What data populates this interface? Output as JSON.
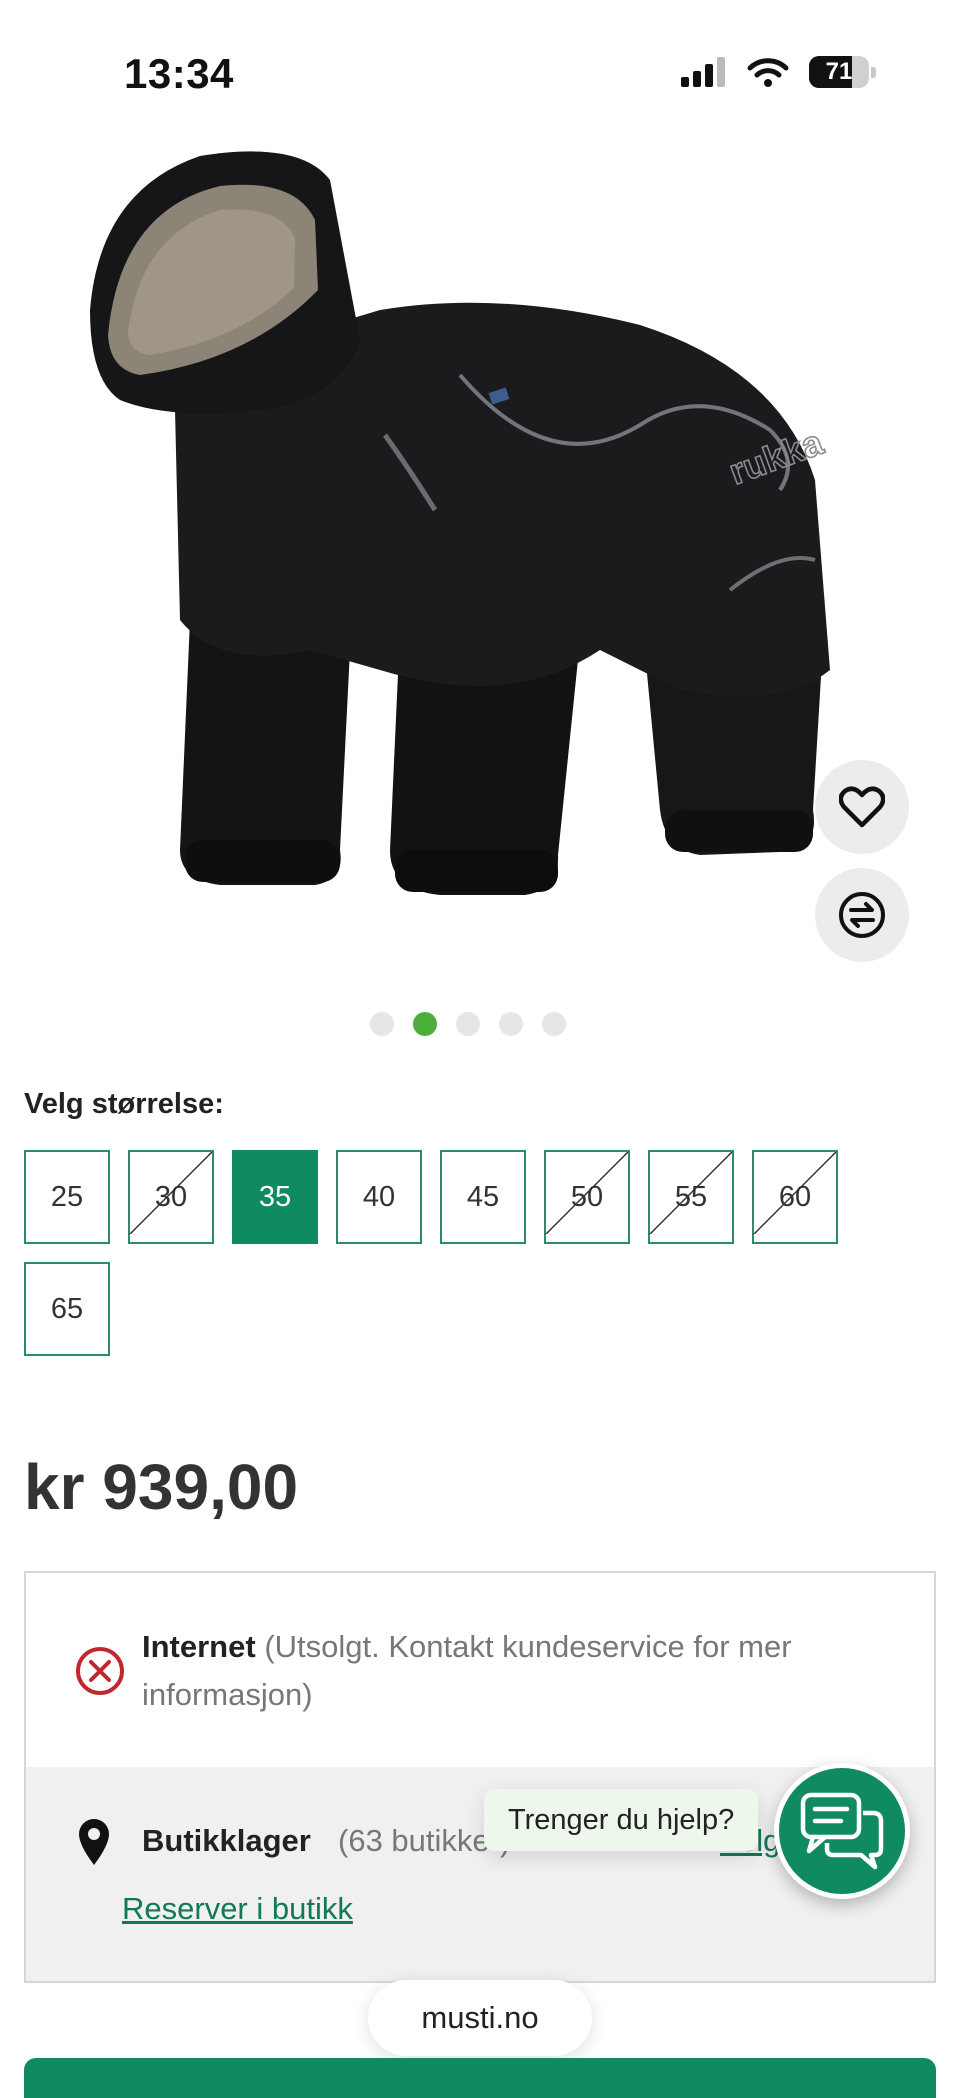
{
  "status_bar": {
    "time": "13:34",
    "battery_level": "71",
    "battery_fraction": 0.71
  },
  "product": {
    "image_icon": "dog-winter-overall-photo",
    "brand_mark": "rukka",
    "gallery": {
      "total": 5,
      "active_index": 1
    },
    "actions": {
      "favorite_icon": "heart-icon",
      "compare_icon": "compare-arrows-icon"
    }
  },
  "sizes": {
    "label": "Velg størrelse:",
    "options": [
      {
        "label": "25",
        "available": true,
        "selected": false
      },
      {
        "label": "30",
        "available": false,
        "selected": false
      },
      {
        "label": "35",
        "available": true,
        "selected": true
      },
      {
        "label": "40",
        "available": true,
        "selected": false
      },
      {
        "label": "45",
        "available": true,
        "selected": false
      },
      {
        "label": "50",
        "available": false,
        "selected": false
      },
      {
        "label": "55",
        "available": false,
        "selected": false
      },
      {
        "label": "60",
        "available": false,
        "selected": false
      },
      {
        "label": "65",
        "available": true,
        "selected": false
      }
    ]
  },
  "price": "kr 939,00",
  "stock": {
    "online": {
      "title": "Internet",
      "status": "(Utsolgt. Kontakt kundeservice for mer informasjon)",
      "icon": "unavailable-x-icon"
    },
    "stores": {
      "title": "Butikklager",
      "count": "(63 butikker)",
      "link": "Velg",
      "icon": "location-pin-icon",
      "reserve": "Reserver i butikk"
    }
  },
  "chat": {
    "prompt": "Trenger du hjelp?",
    "icon": "chat-icon"
  },
  "browser": {
    "url": "musti.no"
  },
  "colors": {
    "brand_green": "#0f8a62",
    "active_dot": "#4caf3a",
    "link": "#0f7a59"
  }
}
